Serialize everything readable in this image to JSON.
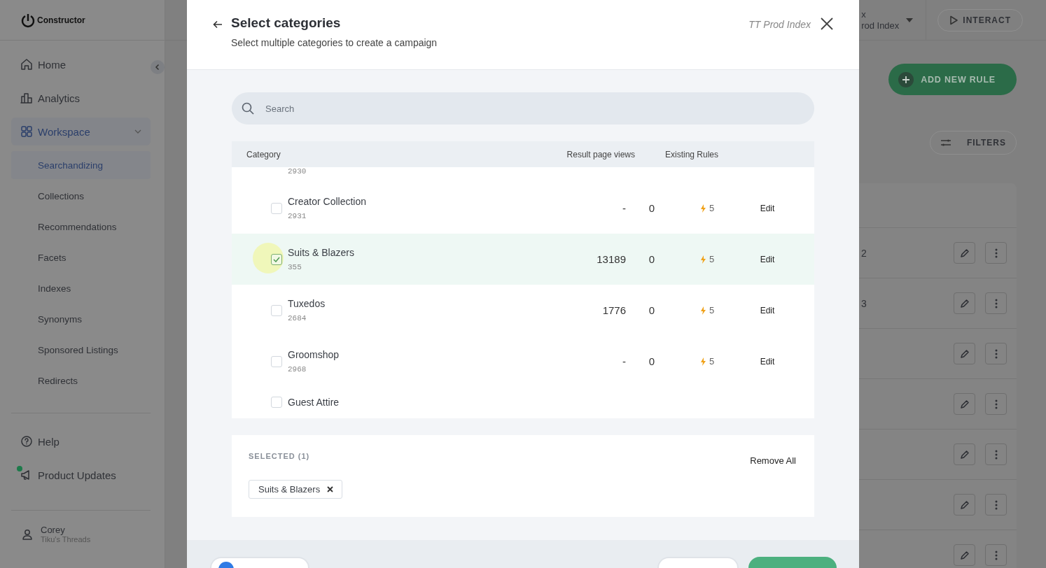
{
  "app": {
    "logo": "Constructor",
    "index_label": "x",
    "index_name": "rod Index",
    "interact": "INTERACT",
    "add_rule": "ADD NEW RULE",
    "filters": "FILTERS",
    "row_fragments": [
      "2",
      "3"
    ]
  },
  "sidebar": {
    "items": [
      {
        "label": "Home",
        "selected": false
      },
      {
        "label": "Analytics",
        "selected": false
      },
      {
        "label": "Workspace",
        "selected": true,
        "expanded": true,
        "children": [
          {
            "label": "Searchandizing",
            "selected": true
          },
          {
            "label": "Collections",
            "selected": false
          },
          {
            "label": "Recommendations",
            "selected": false
          },
          {
            "label": "Facets",
            "selected": false
          },
          {
            "label": "Indexes",
            "selected": false
          },
          {
            "label": "Synonyms",
            "selected": false
          },
          {
            "label": "Sponsored Listings",
            "selected": false
          },
          {
            "label": "Redirects",
            "selected": false
          }
        ]
      }
    ],
    "bottom_items": [
      {
        "label": "Help",
        "badge": false
      },
      {
        "label": "Product Updates",
        "badge": true
      }
    ],
    "user": {
      "name": "Corey",
      "org": "Tiku's Threads"
    }
  },
  "modal": {
    "title": "Select categories",
    "subtitle": "Select multiple categories to create a campaign",
    "index": "TT Prod Index",
    "search": {
      "placeholder": "Search"
    },
    "columns": [
      "Category",
      "Result page views",
      "Existing Rules"
    ],
    "rows": [
      {
        "kind": "tail",
        "id": "2930",
        "checked": false
      },
      {
        "kind": "full",
        "name": "Creator Collection",
        "id": "2931",
        "views": "-",
        "count": "0",
        "rules": "5",
        "action": "Edit",
        "checked": false
      },
      {
        "kind": "full",
        "name": "Suits & Blazers",
        "id": "355",
        "views": "13189",
        "count": "0",
        "rules": "5",
        "action": "Edit",
        "checked": true
      },
      {
        "kind": "full",
        "name": "Tuxedos",
        "id": "2684",
        "views": "1776",
        "count": "0",
        "rules": "5",
        "action": "Edit",
        "checked": false
      },
      {
        "kind": "full",
        "name": "Groomshop",
        "id": "2968",
        "views": "-",
        "count": "0",
        "rules": "5",
        "action": "Edit",
        "checked": false
      },
      {
        "kind": "head",
        "name": "Guest Attire",
        "checked": false
      }
    ],
    "selected_panel": {
      "title": "SELECTED (1)",
      "remove_all": "Remove All",
      "chips": [
        "Suits & Blazers"
      ]
    },
    "footer": {
      "toggle": {
        "on": true
      }
    }
  }
}
